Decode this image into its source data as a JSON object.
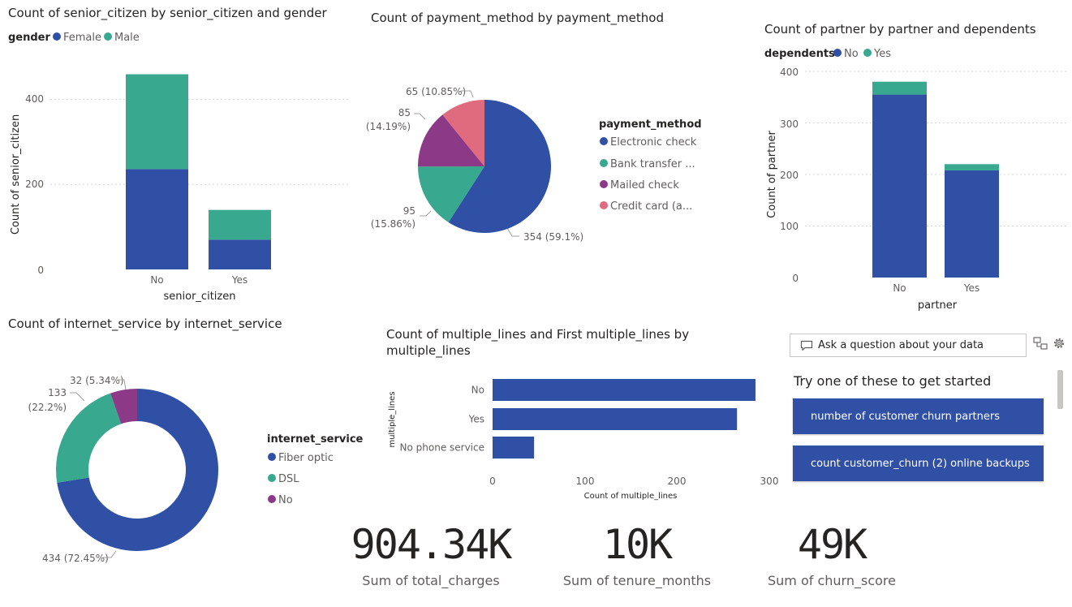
{
  "colors": {
    "blue": "#3050a6",
    "teal": "#38a88e",
    "purple": "#8c3a87",
    "pink": "#e06b7f",
    "text": "#252423",
    "muted": "#605e5c"
  },
  "senior": {
    "title": "Count of senior_citizen by senior_citizen and gender",
    "legend_title": "gender",
    "legend": [
      "Female",
      "Male"
    ],
    "ylabel": "Count of senior_citizen",
    "xlabel": "senior_citizen",
    "yticks": [
      "0",
      "200",
      "400"
    ]
  },
  "payment": {
    "title": "Count of payment_method by payment_method",
    "legend_title": "payment_method",
    "legend": [
      "Electronic check",
      "Bank transfer ...",
      "Mailed check",
      "Credit card (a..."
    ],
    "labels": {
      "l1a": "65 (10.85%)",
      "l2a": "85",
      "l2b": "(14.19%)",
      "l3a": "95",
      "l3b": "(15.86%)",
      "l4a": "354 (59.1%)"
    }
  },
  "partner": {
    "title": "Count of partner by partner and dependents",
    "legend_title": "dependents",
    "legend": [
      "No",
      "Yes"
    ],
    "ylabel": "Count of partner",
    "xlabel": "partner",
    "yticks": [
      "0",
      "100",
      "200",
      "300",
      "400"
    ]
  },
  "internet": {
    "title": "Count of internet_service by internet_service",
    "legend_title": "internet_service",
    "legend": [
      "Fiber optic",
      "DSL",
      "No"
    ],
    "labels": {
      "l1": "32 (5.34%)",
      "l2a": "133",
      "l2b": "(22.2%)",
      "l3": "434 (72.45%)"
    }
  },
  "lines": {
    "title1": "Count of multiple_lines and First multiple_lines by",
    "title2": "multiple_lines",
    "ylabel": "multiple_lines",
    "xlabel": "Count of multiple_lines",
    "xticks": [
      "0",
      "100",
      "200",
      "300"
    ]
  },
  "qa": {
    "placeholder": "Ask a question about your data",
    "try_title": "Try one of these to get started",
    "suggestions": [
      "number of customer churn partners",
      "count customer_churn (2) online backups"
    ]
  },
  "cards": [
    {
      "value": "904.34K",
      "label": "Sum of total_charges"
    },
    {
      "value": "10K",
      "label": "Sum of tenure_months"
    },
    {
      "value": "49K",
      "label": "Sum of churn_score"
    }
  ],
  "chart_data": [
    {
      "type": "bar",
      "stacked": true,
      "title": "Count of senior_citizen by senior_citizen and gender",
      "xlabel": "senior_citizen",
      "ylabel": "Count of senior_citizen",
      "categories": [
        "No",
        "Yes"
      ],
      "series": [
        {
          "name": "Female",
          "values": [
            236,
            70
          ]
        },
        {
          "name": "Male",
          "values": [
            223,
            70
          ]
        }
      ],
      "ylim": [
        0,
        460
      ],
      "yticks": [
        0,
        200,
        400
      ],
      "legend": "top-left",
      "grid": true
    },
    {
      "type": "pie",
      "title": "Count of payment_method by payment_method",
      "categories": [
        "Electronic check",
        "Bank transfer ...",
        "Mailed check",
        "Credit card (a..."
      ],
      "values": [
        354,
        95,
        85,
        65
      ],
      "percent": [
        59.1,
        15.86,
        14.19,
        10.85
      ],
      "legend": "right"
    },
    {
      "type": "bar",
      "stacked": true,
      "title": "Count of partner by partner and dependents",
      "xlabel": "partner",
      "ylabel": "Count of partner",
      "categories": [
        "No",
        "Yes"
      ],
      "series": [
        {
          "name": "No",
          "values": [
            355,
            208
          ]
        },
        {
          "name": "Yes",
          "values": [
            25,
            12
          ]
        }
      ],
      "ylim": [
        0,
        400
      ],
      "yticks": [
        0,
        100,
        200,
        300,
        400
      ],
      "legend": "top-left",
      "grid": true
    },
    {
      "type": "pie",
      "donut": true,
      "title": "Count of internet_service by internet_service",
      "categories": [
        "Fiber optic",
        "DSL",
        "No"
      ],
      "values": [
        434,
        133,
        32
      ],
      "percent": [
        72.45,
        22.2,
        5.34
      ],
      "legend": "right"
    },
    {
      "type": "bar",
      "orientation": "horizontal",
      "title": "Count of multiple_lines and First multiple_lines by multiple_lines",
      "xlabel": "Count of multiple_lines",
      "ylabel": "multiple_lines",
      "categories": [
        "No",
        "Yes",
        "No phone service"
      ],
      "values": [
        285,
        265,
        45
      ],
      "xlim": [
        0,
        300
      ],
      "xticks": [
        0,
        100,
        200,
        300
      ]
    }
  ]
}
